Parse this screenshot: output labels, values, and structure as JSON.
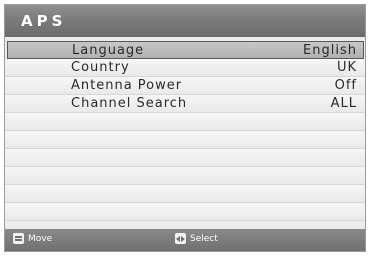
{
  "header": {
    "title": "APS"
  },
  "menu": {
    "items": [
      {
        "label": "Language",
        "value": "English",
        "selected": true
      },
      {
        "label": "Country",
        "value": "UK"
      },
      {
        "label": "Antenna Power",
        "value": "Off"
      },
      {
        "label": "Channel Search",
        "value": "ALL"
      }
    ]
  },
  "footer": {
    "move": {
      "icon": "updown-icon",
      "label": "Move"
    },
    "select": {
      "icon": "leftright-icon",
      "label": "Select"
    }
  }
}
